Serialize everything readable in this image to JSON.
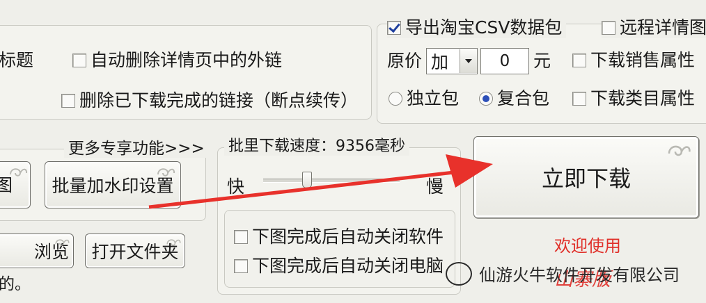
{
  "options_group": {
    "partial_left_label": "标题",
    "auto_delete_external_links": {
      "label": "自动删除详情页中的外链",
      "checked": false
    },
    "delete_downloaded_links": {
      "label": "删除已下载完成的链接（断点续传）",
      "checked": false
    }
  },
  "taobao_group": {
    "export_taobao_csv": {
      "label": "导出淘宝CSV数据包",
      "checked": true
    },
    "remote_detail_image": {
      "label": "远程详情图",
      "checked": false
    },
    "original_price_label": "原价",
    "price_operator": {
      "selected": "加"
    },
    "price_amount": "0",
    "currency_unit": "元",
    "download_sales_attributes": {
      "label": "下载销售属性",
      "checked": false
    },
    "download_category_attributes": {
      "label": "下载类目属性",
      "checked": false
    },
    "package_type": {
      "options": [
        "独立包",
        "复合包"
      ],
      "selected": "复合包"
    }
  },
  "more_features": {
    "title": "更多专享功能>>>",
    "partial_button_label": "图",
    "batch_watermark_button": "批量加水印设置"
  },
  "speed_group": {
    "title": "批里下载速度：9356毫秒",
    "fast_label": "快",
    "slow_label": "慢",
    "close_software_after": {
      "label": "下图完成后自动关闭软件",
      "checked": false
    },
    "shutdown_after": {
      "label": "下图完成后自动关闭电脑",
      "checked": false
    }
  },
  "actions": {
    "download_now_button": "立即下载",
    "browse_button": "浏览",
    "open_folder_button": "打开文件夹",
    "footer_partial_text": "的。"
  },
  "welcome_text_line1": "欢迎使用",
  "welcome_text_line2": "山寨版",
  "watermark_text": "仙游火牛软件开发有限公司",
  "colors": {
    "annotation_arrow": "#e8312b",
    "welcome_text": "#e0302a"
  }
}
